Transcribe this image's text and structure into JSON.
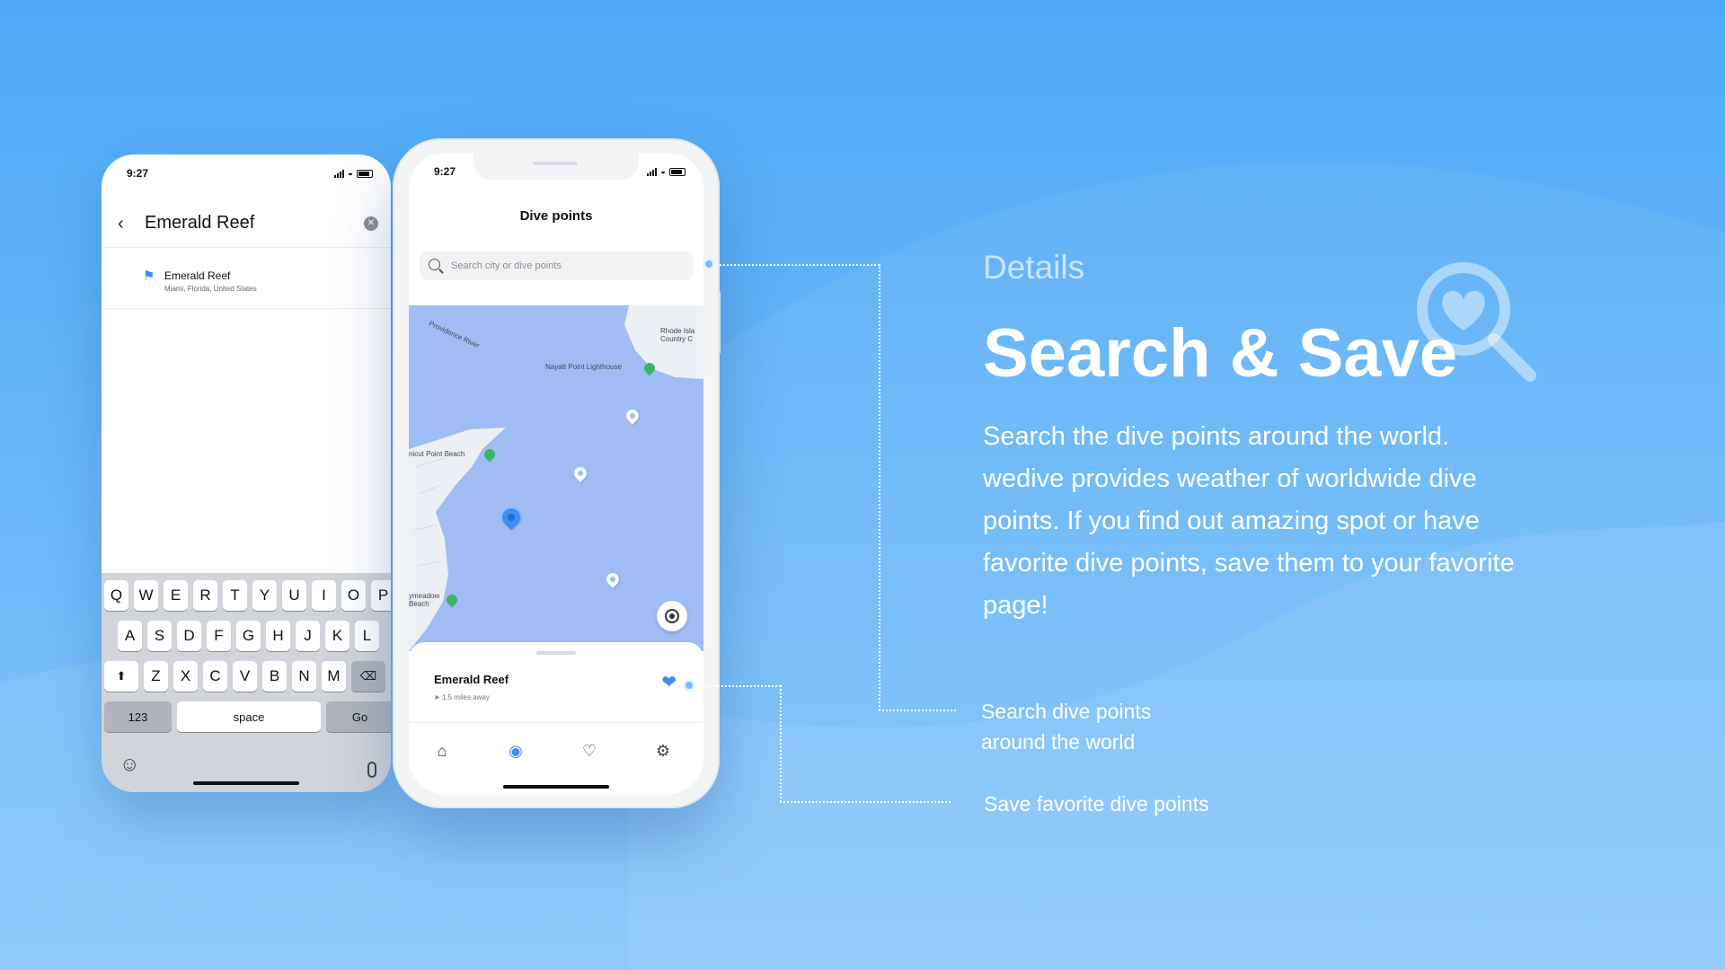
{
  "status": {
    "time": "9:27"
  },
  "search_screen": {
    "title": "Emerald Reef",
    "back_icon": "chevron-left-icon",
    "clear_icon": "clear-icon",
    "result": {
      "name": "Emerald Reef",
      "address": "Miami, Florida, United States",
      "icon": "flag-icon"
    }
  },
  "keyboard": {
    "row1": [
      "Q",
      "W",
      "E",
      "R",
      "T",
      "Y",
      "U",
      "I",
      "O",
      "P"
    ],
    "row2": [
      "A",
      "S",
      "D",
      "F",
      "G",
      "H",
      "J",
      "K",
      "L"
    ],
    "row3": [
      "Z",
      "X",
      "C",
      "V",
      "B",
      "N",
      "M"
    ],
    "numbers_label": "123",
    "space_label": "space",
    "go_label": "Go"
  },
  "main_screen": {
    "title": "Dive points",
    "search_placeholder": "Search city or dive points",
    "map": {
      "labels": {
        "river": "Providence River",
        "country_club": "Rhode Isla\nCountry C",
        "lighthouse": "Nayatt Point Lighthouse",
        "beach1": "nicut Point Beach",
        "beach2": "ymeadow\nBeach"
      }
    },
    "card": {
      "name": "Emerald Reef",
      "distance": "1.5 miles away"
    },
    "tabs": [
      "home-icon",
      "map-pin-icon",
      "heart-icon",
      "settings-icon"
    ]
  },
  "marketing": {
    "eyebrow": "Details",
    "headline": "Search & Save",
    "description": "Search the dive points around the world. wedive provides weather of worldwide dive points. If you find out amazing spot or have favorite dive points, save them to your favorite page!",
    "callout_search": "Search dive points around the world",
    "callout_save": "Save favorite dive points"
  },
  "colors": {
    "accent": "#3d8ef5",
    "background_top": "#4fa9f7",
    "background_bottom": "#86c6fb",
    "map_water": "#9fbdf4"
  }
}
